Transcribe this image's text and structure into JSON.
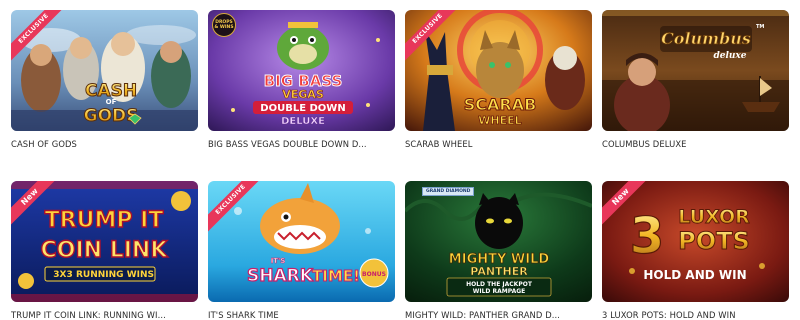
{
  "games": [
    {
      "title": "CASH OF GODS",
      "badge": "EXCLUSIVE",
      "art": {
        "line1": "CASH",
        "line2": "OF",
        "line3": "GODS"
      }
    },
    {
      "title": "BIG BASS VEGAS DOUBLE DOWN D...",
      "badge": "",
      "provider": "DROPS & WINS",
      "art": {
        "line1": "BIG BASS",
        "line2": "VEGAS",
        "line3": "DOUBLE DOWN",
        "line4": "DELUXE"
      }
    },
    {
      "title": "SCARAB WHEEL",
      "badge": "EXCLUSIVE",
      "art": {
        "line1": "SCARAB",
        "line2": "WHEEL"
      }
    },
    {
      "title": "COLUMBUS DELUXE",
      "badge": "",
      "art": {
        "line1": "Columbus",
        "line2": "deluxe"
      }
    },
    {
      "title": "TRUMP IT COIN LINK: RUNNING WI...",
      "badge": "New",
      "art": {
        "line1": "TRUMP IT",
        "line2": "COIN LINK",
        "line3": "3X3",
        "line4": "RUNNING WINS"
      }
    },
    {
      "title": "IT'S SHARK TIME",
      "badge": "EXCLUSIVE",
      "art": {
        "line1": "IT'S",
        "line2": "SHARK",
        "line3": "TIME!",
        "line4": "BONUS"
      }
    },
    {
      "title": "MIGHTY WILD: PANTHER GRAND D...",
      "badge": "",
      "tag": "GRAND DIAMOND",
      "art": {
        "line1": "MIGHTY WILD",
        "line2": "PANTHER",
        "line3": "HOLD THE JACKPOT",
        "line4": "WILD RAMPAGE"
      }
    },
    {
      "title": "3 LUXOR POTS: HOLD AND WIN",
      "badge": "New",
      "art": {
        "line1": "3",
        "line2": "LUXOR",
        "line3": "POTS",
        "line4": "HOLD AND WIN"
      }
    }
  ]
}
